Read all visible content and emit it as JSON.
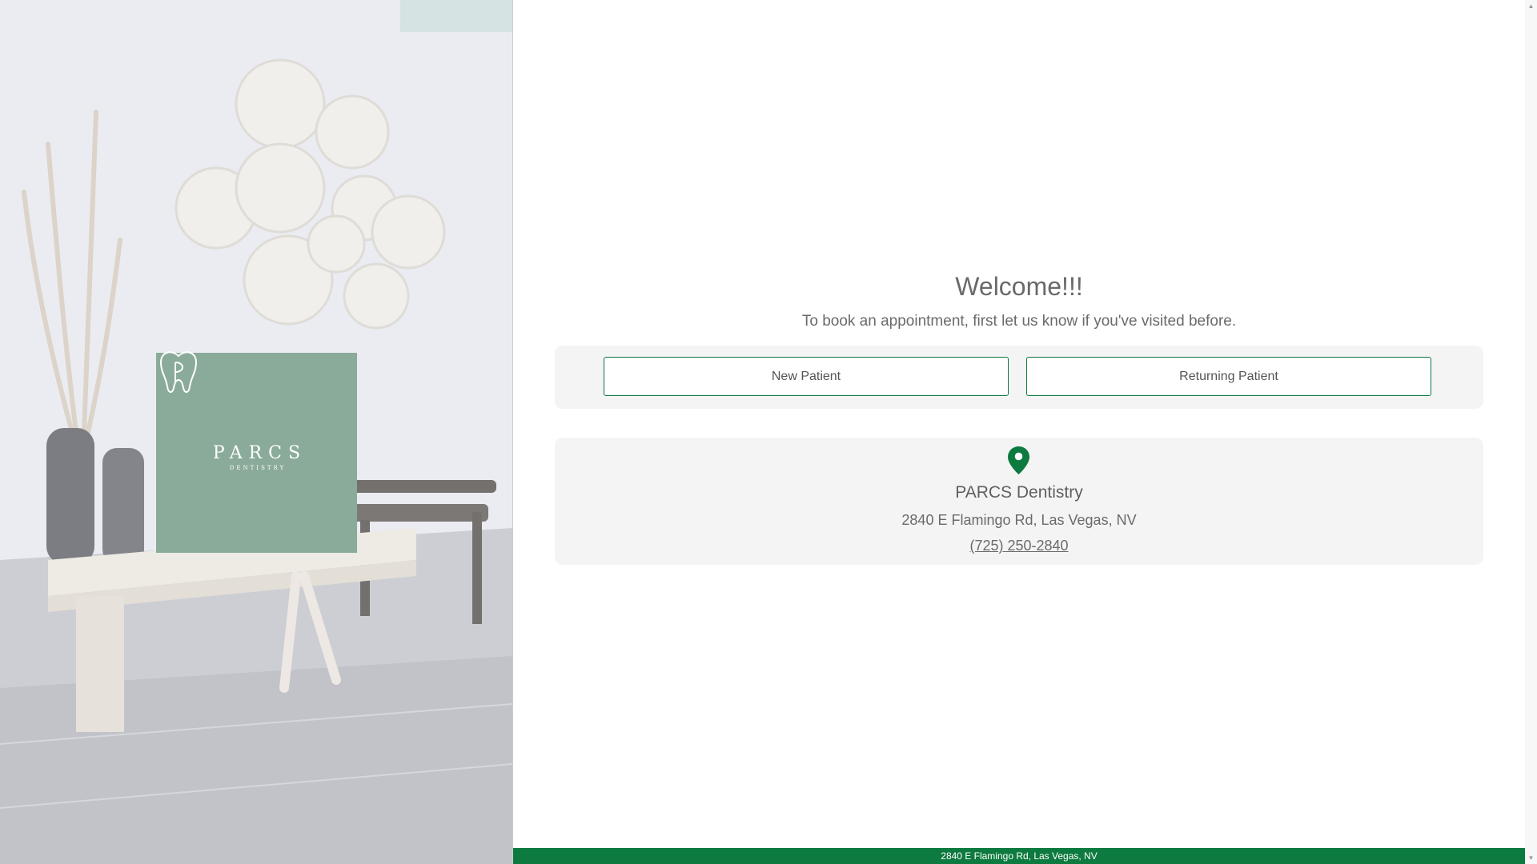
{
  "brand": {
    "logo_word": "PARCS",
    "logo_sub": "DENTISTRY",
    "tile_color": "#8aab99"
  },
  "main": {
    "title": "Welcome!!!",
    "subtitle": "To book an appointment, first let us know if you've visited before.",
    "buttons": {
      "new_patient": "New Patient",
      "returning_patient": "Returning Patient"
    }
  },
  "location": {
    "icon": "map-pin-icon",
    "name": "PARCS Dentistry",
    "address": "2840 E Flamingo Rd, Las Vegas, NV",
    "phone": "(725) 250-2840"
  },
  "footer": {
    "address": "2840 E Flamingo Rd, Las Vegas, NV"
  },
  "colors": {
    "accent": "#0d7a3f",
    "text": "#6a6a6a",
    "panel": "#f4f4f4"
  }
}
